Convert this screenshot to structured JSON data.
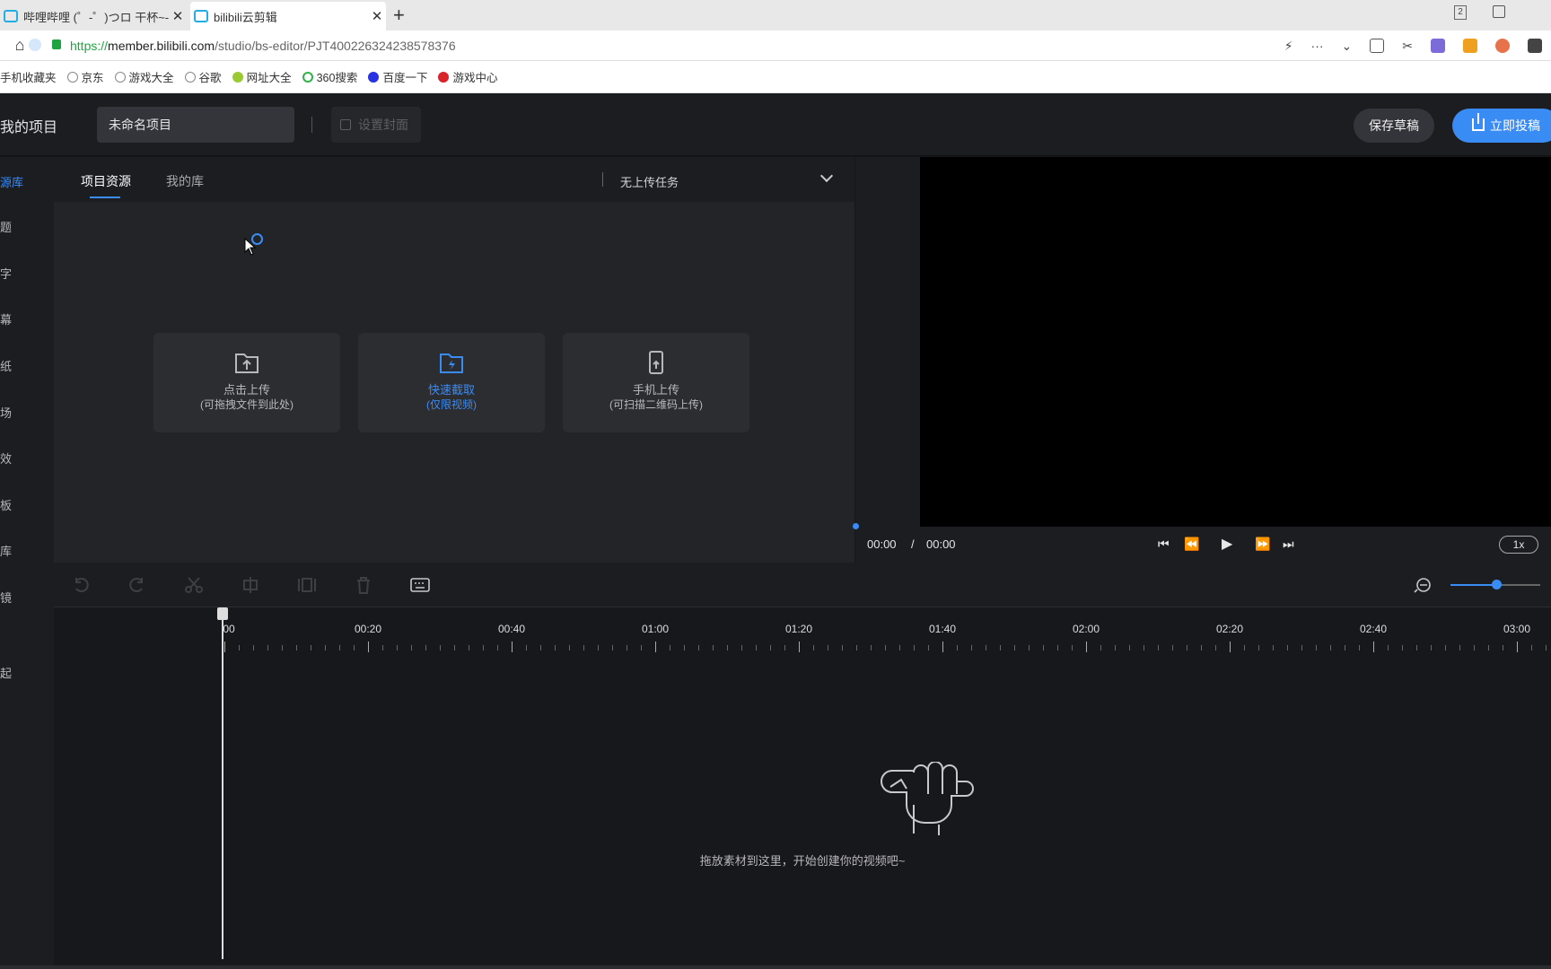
{
  "browser": {
    "tabs": [
      {
        "title": "哔哩哔哩 (゜-゜)つロ 干杯~-b"
      },
      {
        "title": "bilibili云剪辑"
      }
    ],
    "url_scheme": "https://",
    "url_host": "member.bilibili.com",
    "url_path": "/studio/bs-editor/PJT400226324238578376",
    "tab_count_badge": "2",
    "bookmarks": [
      "手机收藏夹",
      "京东",
      "游戏大全",
      "谷歌",
      "网址大全",
      "360搜索",
      "百度一下",
      "游戏中心"
    ]
  },
  "header": {
    "back_label": "我的项目",
    "project_name": "未命名项目",
    "cover_label": "设置封面",
    "save_label": "保存草稿",
    "publish_label": "立即投稿"
  },
  "rail": {
    "items": [
      "源库",
      "题",
      "字",
      "幕",
      "纸",
      "场",
      "效",
      "板",
      "库",
      "镜",
      "起"
    ]
  },
  "resources": {
    "tabs": [
      "项目资源",
      "我的库"
    ],
    "upload_status": "无上传任务",
    "cards": [
      {
        "line1": "点击上传",
        "line2": "(可拖拽文件到此处)"
      },
      {
        "line1": "快速截取",
        "line2": "(仅限视频)"
      },
      {
        "line1": "手机上传",
        "line2": "(可扫描二维码上传)"
      }
    ]
  },
  "player": {
    "current_time": "00:00",
    "separator": "/",
    "total_time": "00:00",
    "speed": "1x"
  },
  "timeline": {
    "ruler_labels": [
      "00",
      "00:20",
      "00:40",
      "01:00",
      "01:20",
      "01:40",
      "02:00",
      "02:20",
      "02:40",
      "03:00"
    ],
    "empty_text": "拖放素材到这里，开始创建你的视频吧~"
  },
  "colors": {
    "accent": "#3a8cf5",
    "background": "#16171b",
    "panel": "#232427"
  }
}
